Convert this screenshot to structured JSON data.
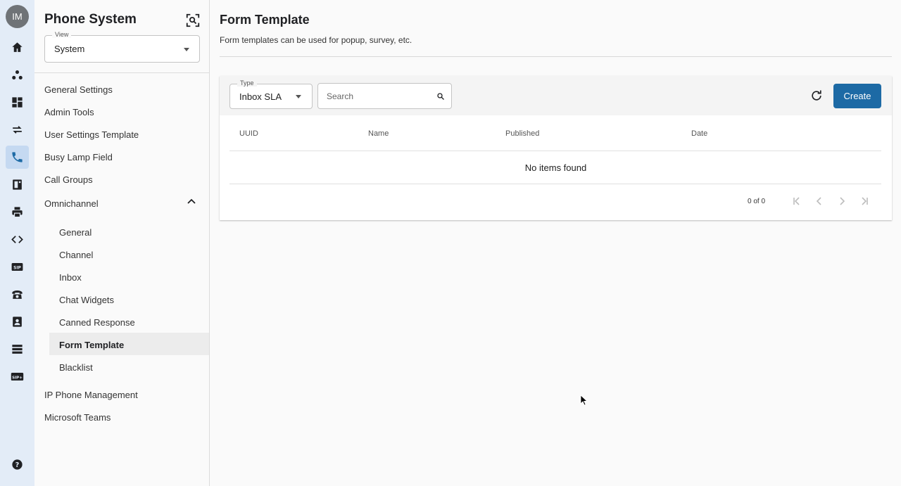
{
  "rail": {
    "avatar": "IM",
    "icons": [
      "home-icon",
      "hierarchy-icon",
      "dashboard-icon",
      "transfer-icon",
      "phone-icon",
      "fax-icon",
      "printer-icon",
      "code-icon",
      "sip-icon",
      "rotary-phone-icon",
      "contacts-icon",
      "list-icon",
      "sip-plus-icon",
      "help-icon"
    ],
    "active": "phone-icon",
    "accent": "#1d6aa5"
  },
  "sidebar": {
    "title": "Phone System",
    "view": {
      "label": "View",
      "value": "System"
    },
    "items": [
      "General Settings",
      "Admin Tools",
      "User Settings Template",
      "Busy Lamp Field",
      "Call Groups",
      "Omnichannel"
    ],
    "omnichannel_sub": [
      "General",
      "Channel",
      "Inbox",
      "Chat Widgets",
      "Canned Response",
      "Form Template",
      "Blacklist"
    ],
    "selected": "Form Template",
    "items_after": [
      "IP Phone Management",
      "Microsoft Teams"
    ]
  },
  "main": {
    "title": "Form Template",
    "description": "Form templates can be used for popup, survey, etc.",
    "toolbar": {
      "type_label": "Type",
      "type_value": "Inbox SLA",
      "search_placeholder": "Search",
      "create_label": "Create"
    },
    "table": {
      "columns": [
        "UUID",
        "Name",
        "Published",
        "Date"
      ],
      "empty_message": "No items found"
    },
    "pagination": {
      "range": "0 of 0"
    }
  }
}
